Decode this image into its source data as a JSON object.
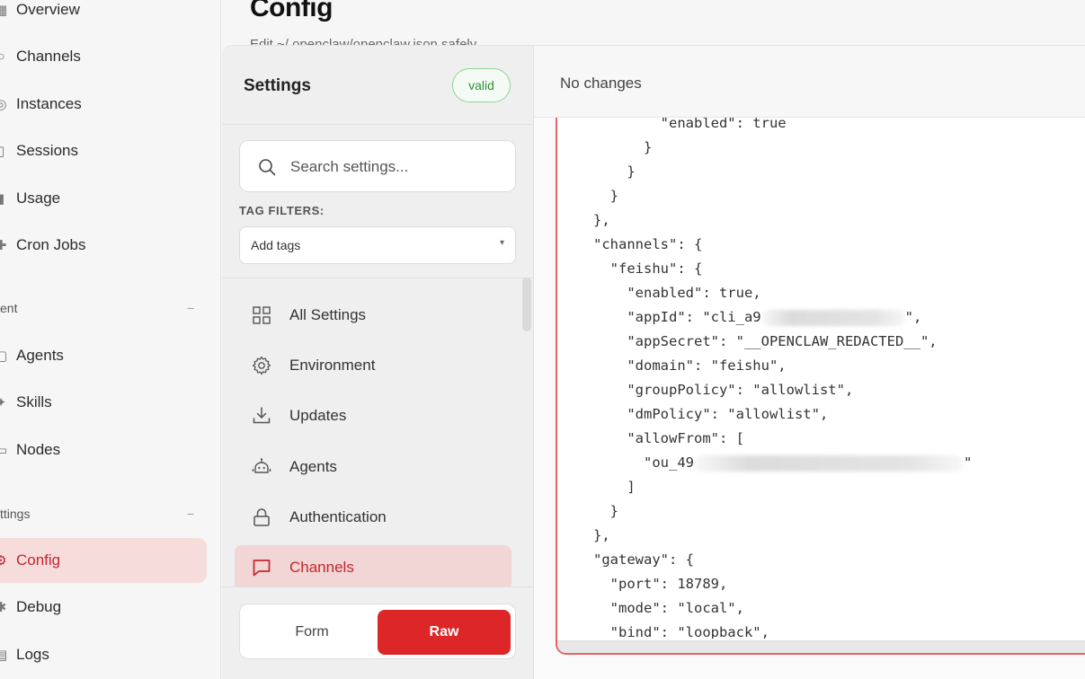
{
  "nav": {
    "items_top": [
      {
        "label": "Overview",
        "icon": "grid-icon"
      },
      {
        "label": "Channels",
        "icon": "link-icon"
      },
      {
        "label": "Instances",
        "icon": "radio-icon"
      },
      {
        "label": "Sessions",
        "icon": "file-icon"
      },
      {
        "label": "Usage",
        "icon": "bar-icon"
      },
      {
        "label": "Cron Jobs",
        "icon": "clock-icon"
      }
    ],
    "section_agent": {
      "label": "ent",
      "collapse": "−"
    },
    "items_agent": [
      {
        "label": "Agents",
        "icon": "folder-icon"
      },
      {
        "label": "Skills",
        "icon": "spark-icon"
      },
      {
        "label": "Nodes",
        "icon": "monitor-icon"
      }
    ],
    "section_settings": {
      "label": "ttings",
      "collapse": "−"
    },
    "items_settings": [
      {
        "label": "Config",
        "icon": "gear-icon",
        "active": true
      },
      {
        "label": "Debug",
        "icon": "bug-icon"
      },
      {
        "label": "Logs",
        "icon": "log-icon"
      }
    ]
  },
  "header": {
    "title": "Config",
    "subtitle": "Edit ~/.openclaw/openclaw.json safely."
  },
  "settings": {
    "title": "Settings",
    "status_badge": "valid",
    "search_placeholder": "Search settings...",
    "tag_filters_label": "TAG FILTERS:",
    "tag_select_value": "Add tags",
    "items": [
      {
        "label": "All Settings",
        "icon": "grid-icon"
      },
      {
        "label": "Environment",
        "icon": "gear-icon"
      },
      {
        "label": "Updates",
        "icon": "download-icon"
      },
      {
        "label": "Agents",
        "icon": "robot-icon"
      },
      {
        "label": "Authentication",
        "icon": "lock-icon"
      },
      {
        "label": "Channels",
        "icon": "chat-icon",
        "active": true
      }
    ],
    "mode_form": "Form",
    "mode_raw": "Raw",
    "mode_selected": "Raw"
  },
  "editor": {
    "changes_text": "No changes",
    "lines": [
      "        \"enabled\": true",
      "      }",
      "    }",
      "  }",
      "},",
      "\"channels\": {",
      "  \"feishu\": {",
      "    \"enabled\": true,",
      "    \"appId\": \"cli_a9",
      "    \"appSecret\": \"__OPENCLAW_REDACTED__\",",
      "    \"domain\": \"feishu\",",
      "    \"groupPolicy\": \"allowlist\",",
      "    \"dmPolicy\": \"allowlist\",",
      "    \"allowFrom\": [",
      "      \"ou_49",
      "    ]",
      "  }",
      "},",
      "\"gateway\": {",
      "  \"port\": 18789,",
      "  \"mode\": \"local\",",
      "  \"bind\": \"loopback\","
    ],
    "redacted_suffixes": {
      "8": "\",",
      "14": "\""
    }
  },
  "colors": {
    "accent": "#dc2627",
    "active_bg": "#f7dcdc",
    "valid_green": "#2f8f3a"
  }
}
